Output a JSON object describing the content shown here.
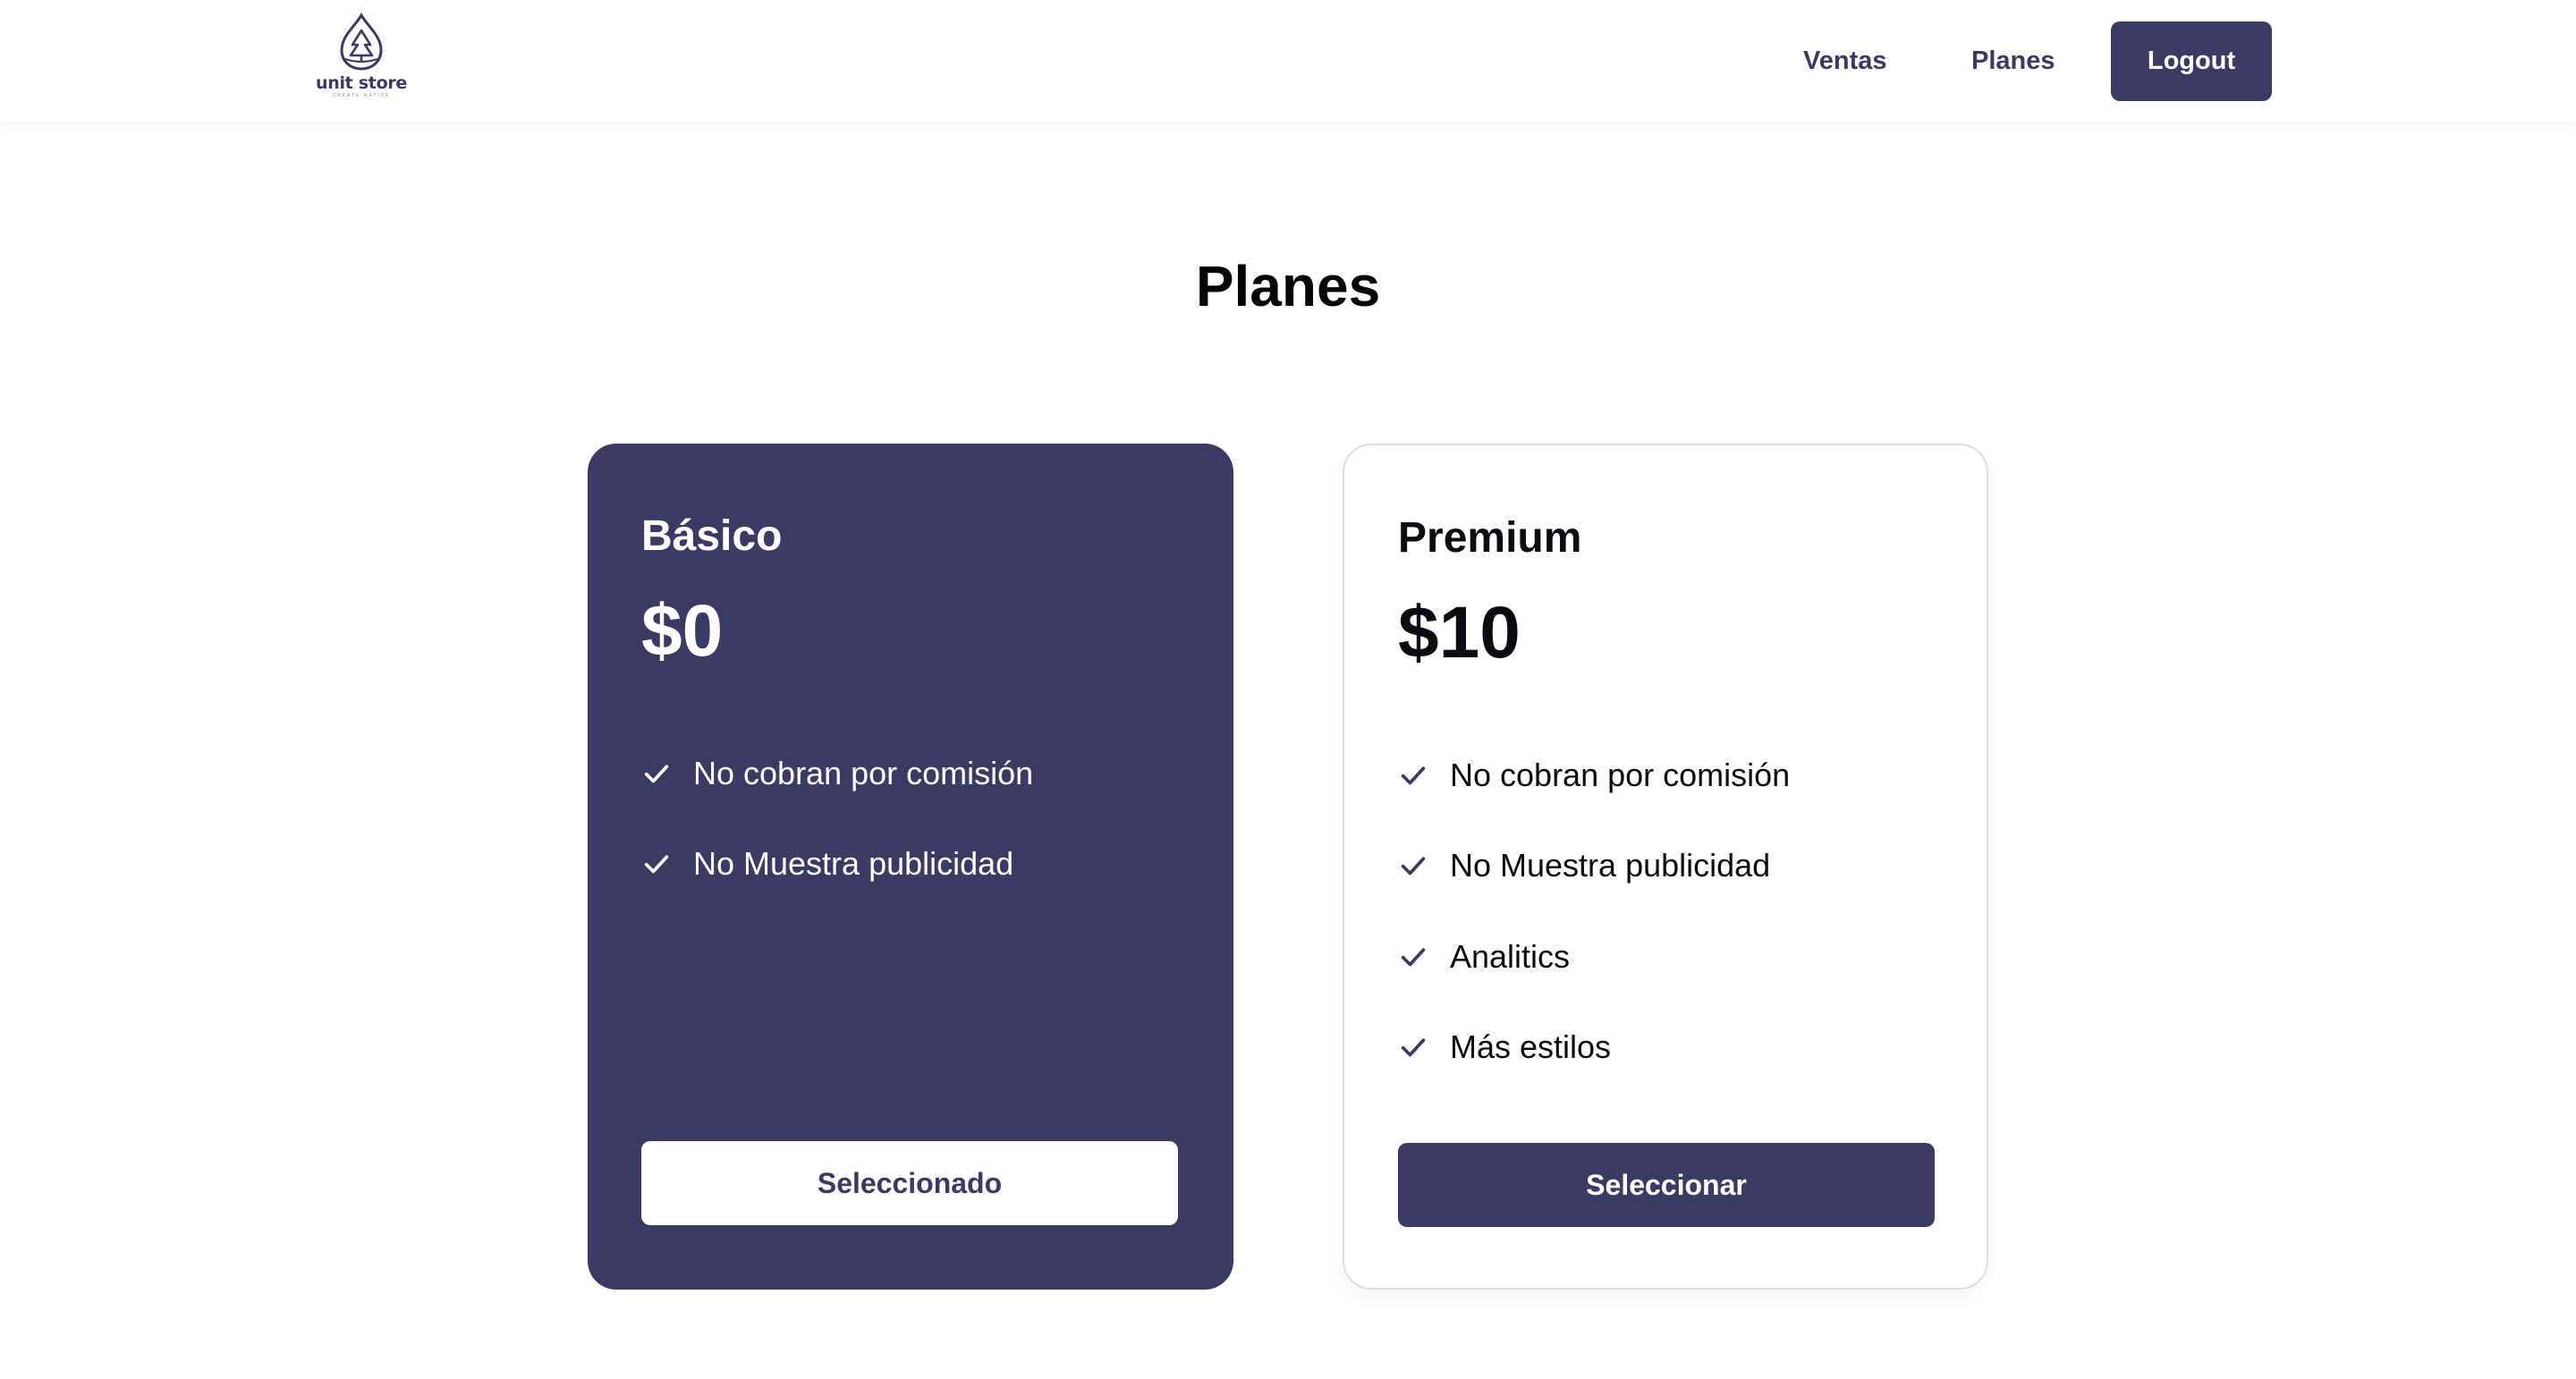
{
  "brand": {
    "name": "unit store",
    "tagline": "CREATE NATIVE",
    "icon": "tree-drop-logo",
    "color": "#3c3a62"
  },
  "nav": {
    "links": [
      "Ventas",
      "Planes"
    ],
    "logout_label": "Logout"
  },
  "page": {
    "title": "Planes"
  },
  "plans": [
    {
      "name": "Básico",
      "price": "$0",
      "selected": true,
      "features": [
        "No cobran por comisión",
        "No Muestra publicidad"
      ],
      "button_label": "Seleccionado"
    },
    {
      "name": "Premium",
      "price": "$10",
      "selected": false,
      "features": [
        "No cobran por comisión",
        "No Muestra publicidad",
        "Analitics",
        "Más estilos"
      ],
      "button_label": "Seleccionar"
    }
  ],
  "icons": {
    "feature": "check-icon"
  },
  "colors": {
    "accent": "#3c3a62",
    "background": "#ffffff",
    "border": "#dcdce4"
  }
}
